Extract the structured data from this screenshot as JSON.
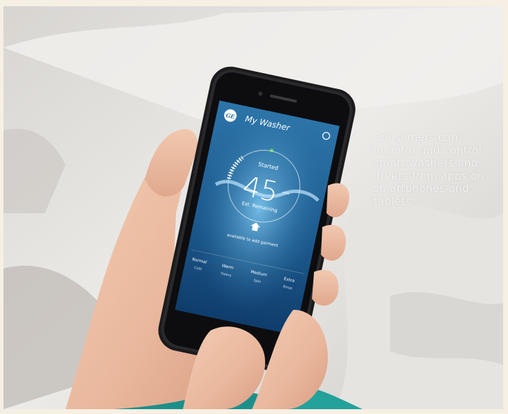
{
  "caption": {
    "text": "Consumers can monitor and control smart washers and dryers from apps on smartphones and tablets."
  },
  "app": {
    "logo": "GE",
    "title": "My Washer",
    "status": "Started",
    "time": "45",
    "time_unit": "min",
    "est_label": "Est. Remaining",
    "note": "available to add garment",
    "cycle_options": [
      {
        "label": "Normal",
        "value": "Cold"
      },
      {
        "label": "Warm",
        "value": "Heavy"
      },
      {
        "label": "Medium",
        "value": "Spin"
      },
      {
        "label": "Extra",
        "value": "Rinse"
      }
    ],
    "colors": {
      "screen_top": "#2a6fa3",
      "screen_bottom": "#0e3a66",
      "indicator": "#5fdc5a"
    }
  }
}
